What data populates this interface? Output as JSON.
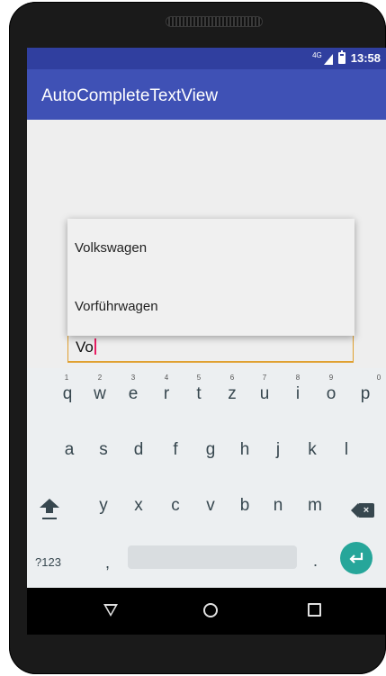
{
  "status": {
    "network": "4G",
    "time": "13:58"
  },
  "appbar": {
    "title": "AutoCompleteTextView"
  },
  "input": {
    "value": "Vo"
  },
  "dropdown": {
    "items": [
      "Volkswagen",
      "Vorführwagen"
    ]
  },
  "keyboard": {
    "row1": [
      "q",
      "w",
      "e",
      "r",
      "t",
      "z",
      "u",
      "i",
      "o",
      "p"
    ],
    "row1_hints": [
      "1",
      "2",
      "3",
      "4",
      "5",
      "6",
      "7",
      "8",
      "9",
      "0"
    ],
    "row2": [
      "a",
      "s",
      "d",
      "f",
      "g",
      "h",
      "j",
      "k",
      "l"
    ],
    "row3": [
      "y",
      "x",
      "c",
      "v",
      "b",
      "n",
      "m"
    ],
    "symbols_label": "?123",
    "comma": ",",
    "period": "."
  },
  "colors": {
    "statusbar": "#303f9f",
    "appbar": "#3f51b5",
    "accent": "#e0a030",
    "enter": "#26a69a"
  },
  "icons": [
    "signal-icon",
    "battery-icon",
    "shift-icon",
    "backspace-icon",
    "enter-icon",
    "nav-back-icon",
    "nav-home-icon",
    "nav-recents-icon"
  ]
}
